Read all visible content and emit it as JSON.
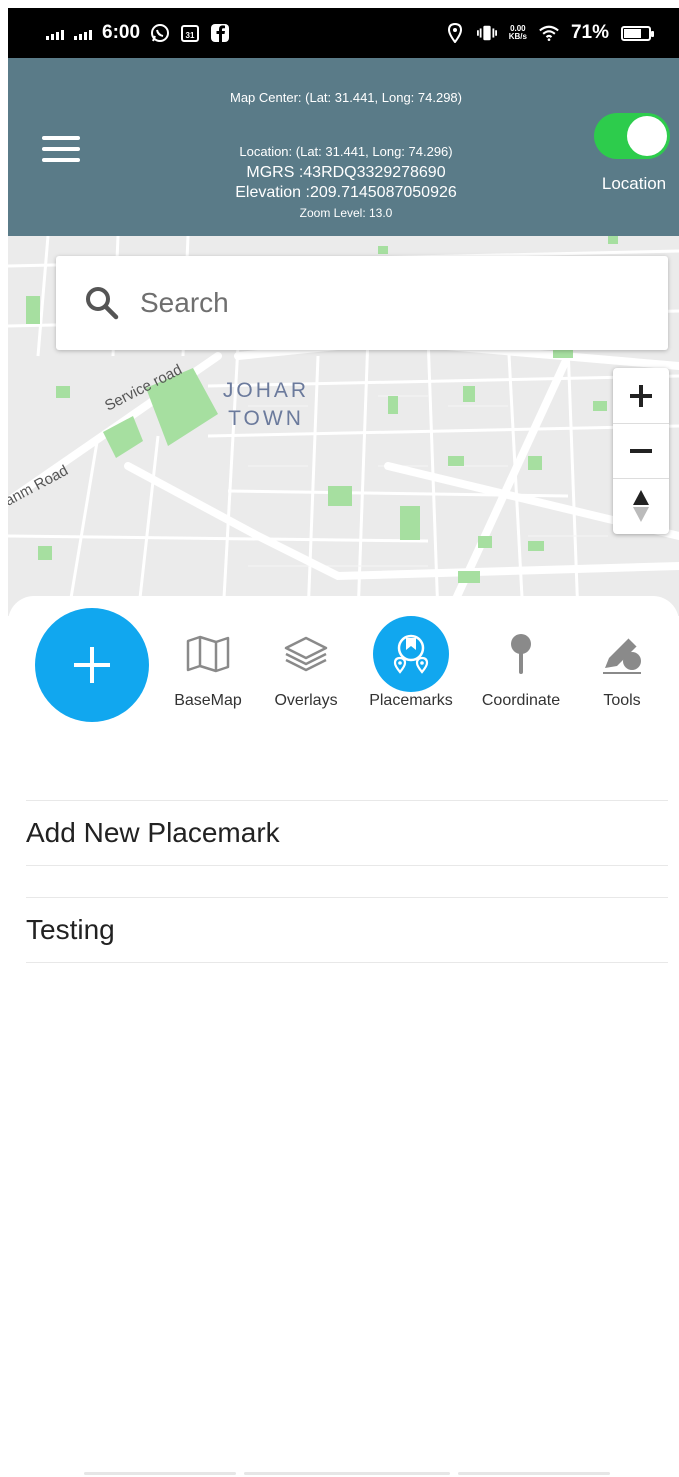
{
  "status_bar": {
    "time": "6:00",
    "battery": "71%",
    "battery_level": 0.71,
    "net_speed_value": "0.00",
    "net_speed_unit": "KB/s",
    "notification_icons": [
      "whatsapp-icon",
      "calendar-icon",
      "facebook-icon"
    ],
    "calendar_day": "31",
    "system_icons": [
      "location-icon",
      "vibrate-icon",
      "wifi-icon",
      "battery-icon"
    ]
  },
  "header": {
    "map_center": "Map Center: (Lat: 31.441, Long: 74.298)",
    "location": "Location: (Lat: 31.441, Long: 74.296)",
    "mgrs": "MGRS :43RDQ3329278690",
    "elevation": "Elevation :209.7145087050926",
    "zoom_level": "Zoom Level: 13.0",
    "location_toggle_label": "Location",
    "location_toggle_on": true,
    "toggle_color": "#2dcc4c",
    "background_color": "#5a7b88"
  },
  "map": {
    "labels": {
      "area_line1": "JOHAR",
      "area_line2": "TOWN",
      "road_service": "Service road",
      "road_left": "anm Road"
    }
  },
  "search": {
    "placeholder": "Search"
  },
  "toolbar": {
    "accent_color": "#11a7ef",
    "items": [
      {
        "label": "BaseMap",
        "icon": "map-icon",
        "active": false
      },
      {
        "label": "Overlays",
        "icon": "layers-icon",
        "active": false
      },
      {
        "label": "Placemarks",
        "icon": "placemarks-icon",
        "active": true
      },
      {
        "label": "Coordinate",
        "icon": "pin-icon",
        "active": false
      },
      {
        "label": "Tools",
        "icon": "pencil-tools-icon",
        "active": false
      }
    ]
  },
  "placemarks": {
    "items": [
      "Add New Placemark",
      "Testing"
    ]
  }
}
